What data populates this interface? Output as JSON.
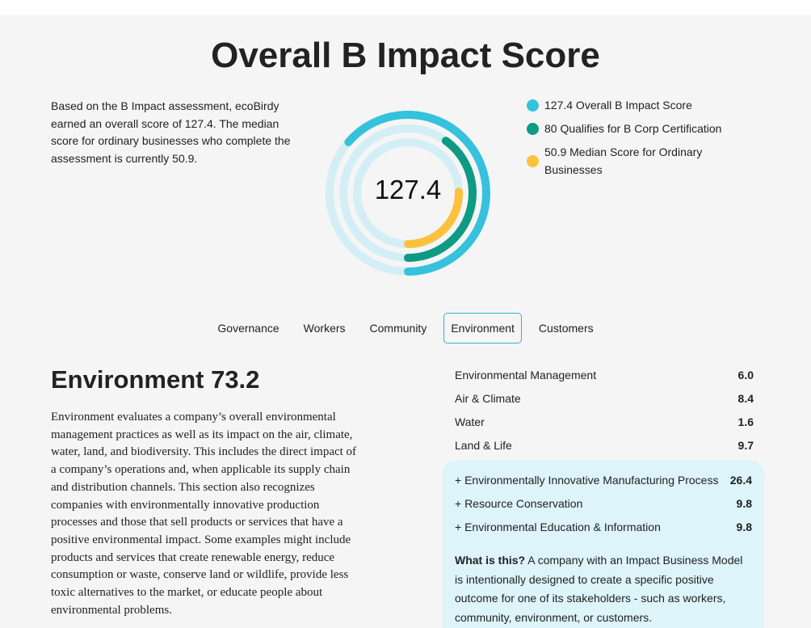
{
  "page": {
    "title": "Overall B Impact Score",
    "intro": "Based on the B Impact assessment, ecoBirdy earned an overall score of 127.4. The median score for ordinary businesses who complete the assessment is currently 50.9."
  },
  "ring": {
    "center_label": "127.4",
    "max_scale": 200,
    "rings": [
      {
        "value": 127.4,
        "color": "#36c1dd",
        "track": "#d3eef5"
      },
      {
        "value": 80,
        "color": "#0e9a83",
        "track": "#d3eef5"
      },
      {
        "value": 50.9,
        "color": "#fdc13e",
        "track": "#d3eef5"
      }
    ]
  },
  "legend": {
    "items": [
      {
        "label": "127.4 Overall B Impact Score",
        "color": "#36c1dd"
      },
      {
        "label": "80 Qualifies for B Corp Certification",
        "color": "#0e9a83"
      },
      {
        "label": "50.9 Median Score for Ordinary Businesses",
        "color": "#fdc13e"
      }
    ]
  },
  "tabs": {
    "items": [
      "Governance",
      "Workers",
      "Community",
      "Environment",
      "Customers"
    ],
    "active": "Environment"
  },
  "section": {
    "title": "Environment 73.2",
    "description": "Environment evaluates a company’s overall environmental management practices as well as its impact on the air, climate, water, land, and biodiversity. This includes the direct impact of a company’s operations and, when applicable its supply chain and distribution channels. This section also recognizes companies with environmentally innovative production processes and those that sell products or services that have a positive environmental impact. Some examples might include products and services that create renewable energy, reduce consumption or waste, conserve land or wildlife, provide less toxic alternatives to the market, or educate people about environmental problems."
  },
  "scores": {
    "rows": [
      {
        "label": "Environmental Management",
        "value": "6.0"
      },
      {
        "label": "Air & Climate",
        "value": "8.4"
      },
      {
        "label": "Water",
        "value": "1.6"
      },
      {
        "label": "Land & Life",
        "value": "9.7"
      }
    ]
  },
  "impact_business_model": {
    "rows": [
      {
        "label": "+ Environmentally Innovative Manufacturing Process",
        "value": "26.4"
      },
      {
        "label": "+ Resource Conservation",
        "value": "9.8"
      },
      {
        "label": "+ Environmental Education & Information",
        "value": "9.8"
      }
    ],
    "note_question": "What is this?",
    "note_text": " A company with an Impact Business Model is intentionally designed to create a specific positive outcome for one of its stakeholders - such as workers, community, environment, or customers."
  }
}
